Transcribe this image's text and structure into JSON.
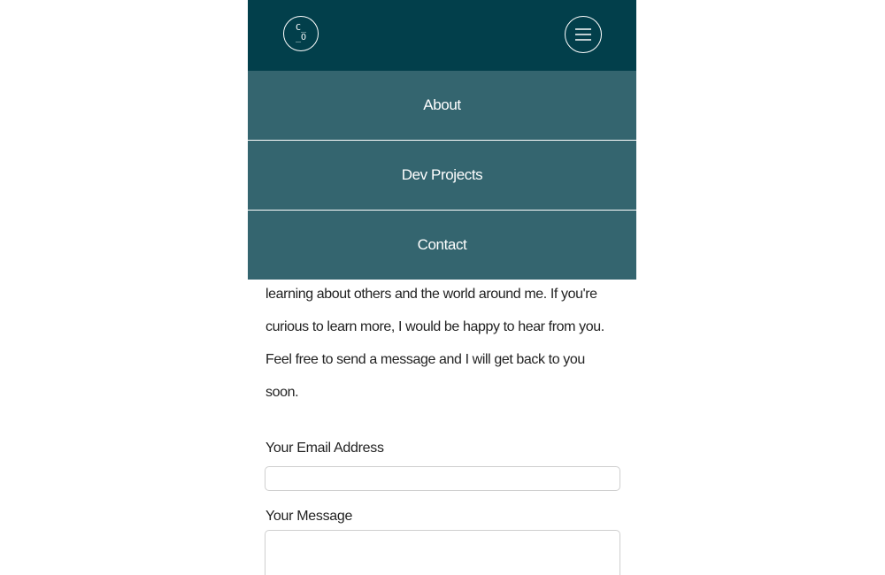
{
  "header": {
    "logo_line1": "C_",
    "logo_line2": "_O",
    "menu_icon": "hamburger-icon",
    "background_color": "#023f4b"
  },
  "nav": {
    "background_color": "#34656f",
    "items": [
      {
        "label": "About"
      },
      {
        "label": "Dev Projects"
      },
      {
        "label": "Contact"
      }
    ]
  },
  "content": {
    "paragraph_lines": [
      "learning about others and the world around me. If you're",
      "curious to learn more, I would be happy to hear from you.",
      "Feel free to send a message and I will get back to you",
      "soon."
    ]
  },
  "form": {
    "email_label": "Your Email Address",
    "email_value": "",
    "message_label": "Your Message",
    "message_value": ""
  }
}
